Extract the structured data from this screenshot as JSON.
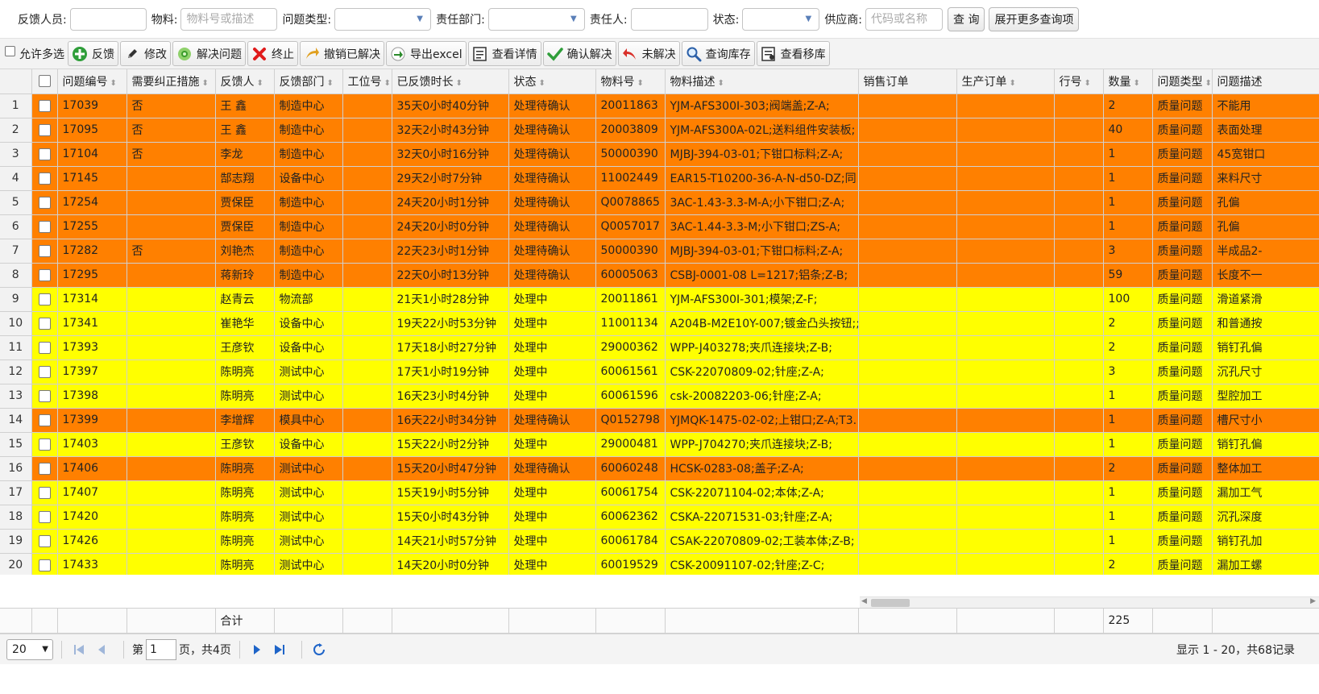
{
  "search": {
    "feedback_person_label": "反馈人员:",
    "material_label": "物料:",
    "material_placeholder": "物料号或描述",
    "problem_type_label": "问题类型:",
    "dept_label": "责任部门:",
    "responsible_label": "责任人:",
    "status_label": "状态:",
    "supplier_label": "供应商:",
    "supplier_placeholder": "代码或名称",
    "query_button": "查 询",
    "more_button": "展开更多查询项"
  },
  "toolbar": {
    "multi_select": "允许多选",
    "buttons": [
      {
        "label": "反馈",
        "icon": "plus-icon"
      },
      {
        "label": "修改",
        "icon": "pencil-icon"
      },
      {
        "label": "解决问题",
        "icon": "gear-icon"
      },
      {
        "label": "终止",
        "icon": "x-icon"
      },
      {
        "label": "撤销已解决",
        "icon": "undo-icon"
      },
      {
        "label": "导出excel",
        "icon": "export-icon"
      },
      {
        "label": "查看详情",
        "icon": "detail-icon"
      },
      {
        "label": "确认解决",
        "icon": "check-icon"
      },
      {
        "label": "未解决",
        "icon": "back-icon"
      },
      {
        "label": "查询库存",
        "icon": "search-icon"
      },
      {
        "label": "查看移库",
        "icon": "list-icon"
      }
    ]
  },
  "colors": {
    "processing_confirm": "#ff8000",
    "processing": "#ffff00"
  },
  "grid": {
    "columns": [
      "问题编号",
      "需要纠正措施",
      "反馈人",
      "反馈部门",
      "工位号",
      "已反馈时长",
      "状态",
      "物料号",
      "物料描述",
      "销售订单",
      "生产订单",
      "行号",
      "数量",
      "问题类型",
      "问题描述"
    ],
    "rows": [
      {
        "n": "1",
        "id": "17039",
        "cor": "否",
        "person": "王 鑫",
        "dept": "制造中心",
        "station": "",
        "dur": "35天0小时40分钟",
        "status": "处理待确认",
        "mat": "20011863",
        "desc": "YJM-AFS300I-303;阀端盖;Z-A;",
        "so": "",
        "po": "",
        "line": "",
        "qty": "2",
        "type": "质量问题",
        "pdesc": "不能用",
        "color": "orange"
      },
      {
        "n": "2",
        "id": "17095",
        "cor": "否",
        "person": "王 鑫",
        "dept": "制造中心",
        "station": "",
        "dur": "32天2小时43分钟",
        "status": "处理待确认",
        "mat": "20003809",
        "desc": "YJM-AFS300A-02L;送料组件安装板;",
        "so": "",
        "po": "",
        "line": "",
        "qty": "40",
        "type": "质量问题",
        "pdesc": "表面处理",
        "color": "orange"
      },
      {
        "n": "3",
        "id": "17104",
        "cor": "否",
        "person": "李龙",
        "dept": "制造中心",
        "station": "",
        "dur": "32天0小时16分钟",
        "status": "处理待确认",
        "mat": "50000390",
        "desc": "MJBJ-394-03-01;下钳口标料;Z-A;",
        "so": "",
        "po": "",
        "line": "",
        "qty": "1",
        "type": "质量问题",
        "pdesc": "45宽钳口",
        "color": "orange"
      },
      {
        "n": "4",
        "id": "17145",
        "cor": "",
        "person": "郜志翔",
        "dept": "设备中心",
        "station": "",
        "dur": "29天2小时7分钟",
        "status": "处理待确认",
        "mat": "11002449",
        "desc": "EAR15-T10200-36-A-N-d50-DZ;同",
        "so": "",
        "po": "",
        "line": "",
        "qty": "1",
        "type": "质量问题",
        "pdesc": "来料尺寸",
        "color": "orange"
      },
      {
        "n": "5",
        "id": "17254",
        "cor": "",
        "person": "贾保臣",
        "dept": "制造中心",
        "station": "",
        "dur": "24天20小时1分钟",
        "status": "处理待确认",
        "mat": "Q0078865",
        "desc": "3AC-1.43-3.3-M-A;小下钳口;Z-A;",
        "so": "",
        "po": "",
        "line": "",
        "qty": "1",
        "type": "质量问题",
        "pdesc": "孔偏",
        "color": "orange"
      },
      {
        "n": "6",
        "id": "17255",
        "cor": "",
        "person": "贾保臣",
        "dept": "制造中心",
        "station": "",
        "dur": "24天20小时0分钟",
        "status": "处理待确认",
        "mat": "Q0057017",
        "desc": "3AC-1.44-3.3-M;小下钳口;ZS-A;",
        "so": "",
        "po": "",
        "line": "",
        "qty": "1",
        "type": "质量问题",
        "pdesc": "孔偏",
        "color": "orange"
      },
      {
        "n": "7",
        "id": "17282",
        "cor": "否",
        "person": "刘艳杰",
        "dept": "制造中心",
        "station": "",
        "dur": "22天23小时1分钟",
        "status": "处理待确认",
        "mat": "50000390",
        "desc": "MJBJ-394-03-01;下钳口标料;Z-A;",
        "so": "",
        "po": "",
        "line": "",
        "qty": "3",
        "type": "质量问题",
        "pdesc": "半成品2-",
        "color": "orange"
      },
      {
        "n": "8",
        "id": "17295",
        "cor": "",
        "person": "蒋新玲",
        "dept": "制造中心",
        "station": "",
        "dur": "22天0小时13分钟",
        "status": "处理待确认",
        "mat": "60005063",
        "desc": "CSBJ-0001-08 L=1217;铝条;Z-B;",
        "so": "",
        "po": "",
        "line": "",
        "qty": "59",
        "type": "质量问题",
        "pdesc": "长度不一",
        "color": "orange"
      },
      {
        "n": "9",
        "id": "17314",
        "cor": "",
        "person": "赵青云",
        "dept": "物流部",
        "station": "",
        "dur": "21天1小时28分钟",
        "status": "处理中",
        "mat": "20011861",
        "desc": "YJM-AFS300I-301;模架;Z-F;",
        "so": "",
        "po": "",
        "line": "",
        "qty": "100",
        "type": "质量问题",
        "pdesc": "滑道紧滑",
        "color": "yellow"
      },
      {
        "n": "10",
        "id": "17341",
        "cor": "",
        "person": "崔艳华",
        "dept": "设备中心",
        "station": "",
        "dur": "19天22小时53分钟",
        "status": "处理中",
        "mat": "11001134",
        "desc": "A204B-M2E10Y-007;镀金凸头按钮;;",
        "so": "",
        "po": "",
        "line": "",
        "qty": "2",
        "type": "质量问题",
        "pdesc": "和普通按",
        "color": "yellow"
      },
      {
        "n": "11",
        "id": "17393",
        "cor": "",
        "person": "王彦钦",
        "dept": "设备中心",
        "station": "",
        "dur": "17天18小时27分钟",
        "status": "处理中",
        "mat": "29000362",
        "desc": "WPP-J403278;夹爪连接块;Z-B;",
        "so": "",
        "po": "",
        "line": "",
        "qty": "2",
        "type": "质量问题",
        "pdesc": "销钉孔偏",
        "color": "yellow"
      },
      {
        "n": "12",
        "id": "17397",
        "cor": "",
        "person": "陈明亮",
        "dept": "测试中心",
        "station": "",
        "dur": "17天1小时19分钟",
        "status": "处理中",
        "mat": "60061561",
        "desc": "CSK-22070809-02;针座;Z-A;",
        "so": "",
        "po": "",
        "line": "",
        "qty": "3",
        "type": "质量问题",
        "pdesc": "沉孔尺寸",
        "color": "yellow"
      },
      {
        "n": "13",
        "id": "17398",
        "cor": "",
        "person": "陈明亮",
        "dept": "测试中心",
        "station": "",
        "dur": "16天23小时4分钟",
        "status": "处理中",
        "mat": "60061596",
        "desc": "csk-20082203-06;针座;Z-A;",
        "so": "",
        "po": "",
        "line": "",
        "qty": "1",
        "type": "质量问题",
        "pdesc": "型腔加工",
        "color": "yellow"
      },
      {
        "n": "14",
        "id": "17399",
        "cor": "",
        "person": "李增辉",
        "dept": "模具中心",
        "station": "",
        "dur": "16天22小时34分钟",
        "status": "处理待确认",
        "mat": "Q0152798",
        "desc": "YJMQK-1475-02-02;上钳口;Z-A;T3.",
        "so": "",
        "po": "",
        "line": "",
        "qty": "1",
        "type": "质量问题",
        "pdesc": "槽尺寸小",
        "color": "orange"
      },
      {
        "n": "15",
        "id": "17403",
        "cor": "",
        "person": "王彦钦",
        "dept": "设备中心",
        "station": "",
        "dur": "15天22小时2分钟",
        "status": "处理中",
        "mat": "29000481",
        "desc": "WPP-J704270;夹爪连接块;Z-B;",
        "so": "",
        "po": "",
        "line": "",
        "qty": "1",
        "type": "质量问题",
        "pdesc": "销钉孔偏",
        "color": "yellow"
      },
      {
        "n": "16",
        "id": "17406",
        "cor": "",
        "person": "陈明亮",
        "dept": "测试中心",
        "station": "",
        "dur": "15天20小时47分钟",
        "status": "处理待确认",
        "mat": "60060248",
        "desc": "HCSK-0283-08;盖子;Z-A;",
        "so": "",
        "po": "",
        "line": "",
        "qty": "2",
        "type": "质量问题",
        "pdesc": "整体加工",
        "color": "orange"
      },
      {
        "n": "17",
        "id": "17407",
        "cor": "",
        "person": "陈明亮",
        "dept": "测试中心",
        "station": "",
        "dur": "15天19小时5分钟",
        "status": "处理中",
        "mat": "60061754",
        "desc": "CSK-22071104-02;本体;Z-A;",
        "so": "",
        "po": "",
        "line": "",
        "qty": "1",
        "type": "质量问题",
        "pdesc": "漏加工气",
        "color": "yellow"
      },
      {
        "n": "18",
        "id": "17420",
        "cor": "",
        "person": "陈明亮",
        "dept": "测试中心",
        "station": "",
        "dur": "15天0小时43分钟",
        "status": "处理中",
        "mat": "60062362",
        "desc": "CSKA-22071531-03;针座;Z-A;",
        "so": "",
        "po": "",
        "line": "",
        "qty": "1",
        "type": "质量问题",
        "pdesc": "沉孔深度",
        "color": "yellow"
      },
      {
        "n": "19",
        "id": "17426",
        "cor": "",
        "person": "陈明亮",
        "dept": "测试中心",
        "station": "",
        "dur": "14天21小时57分钟",
        "status": "处理中",
        "mat": "60061784",
        "desc": "CSAK-22070809-02;工装本体;Z-B;",
        "so": "",
        "po": "",
        "line": "",
        "qty": "1",
        "type": "质量问题",
        "pdesc": "销钉孔加",
        "color": "yellow"
      },
      {
        "n": "20",
        "id": "17433",
        "cor": "",
        "person": "陈明亮",
        "dept": "测试中心",
        "station": "",
        "dur": "14天20小时0分钟",
        "status": "处理中",
        "mat": "60019529",
        "desc": "CSK-20091107-02;针座;Z-C;",
        "so": "",
        "po": "",
        "line": "",
        "qty": "2",
        "type": "质量问题",
        "pdesc": "漏加工螺",
        "color": "yellow"
      }
    ],
    "footer": {
      "label": "合计",
      "qty_total": "225"
    }
  },
  "pager": {
    "page_size": "20",
    "page_prefix": "第",
    "page_number": "1",
    "page_suffix": "页，共4页",
    "info": "显示 1 - 20，共68记录"
  }
}
